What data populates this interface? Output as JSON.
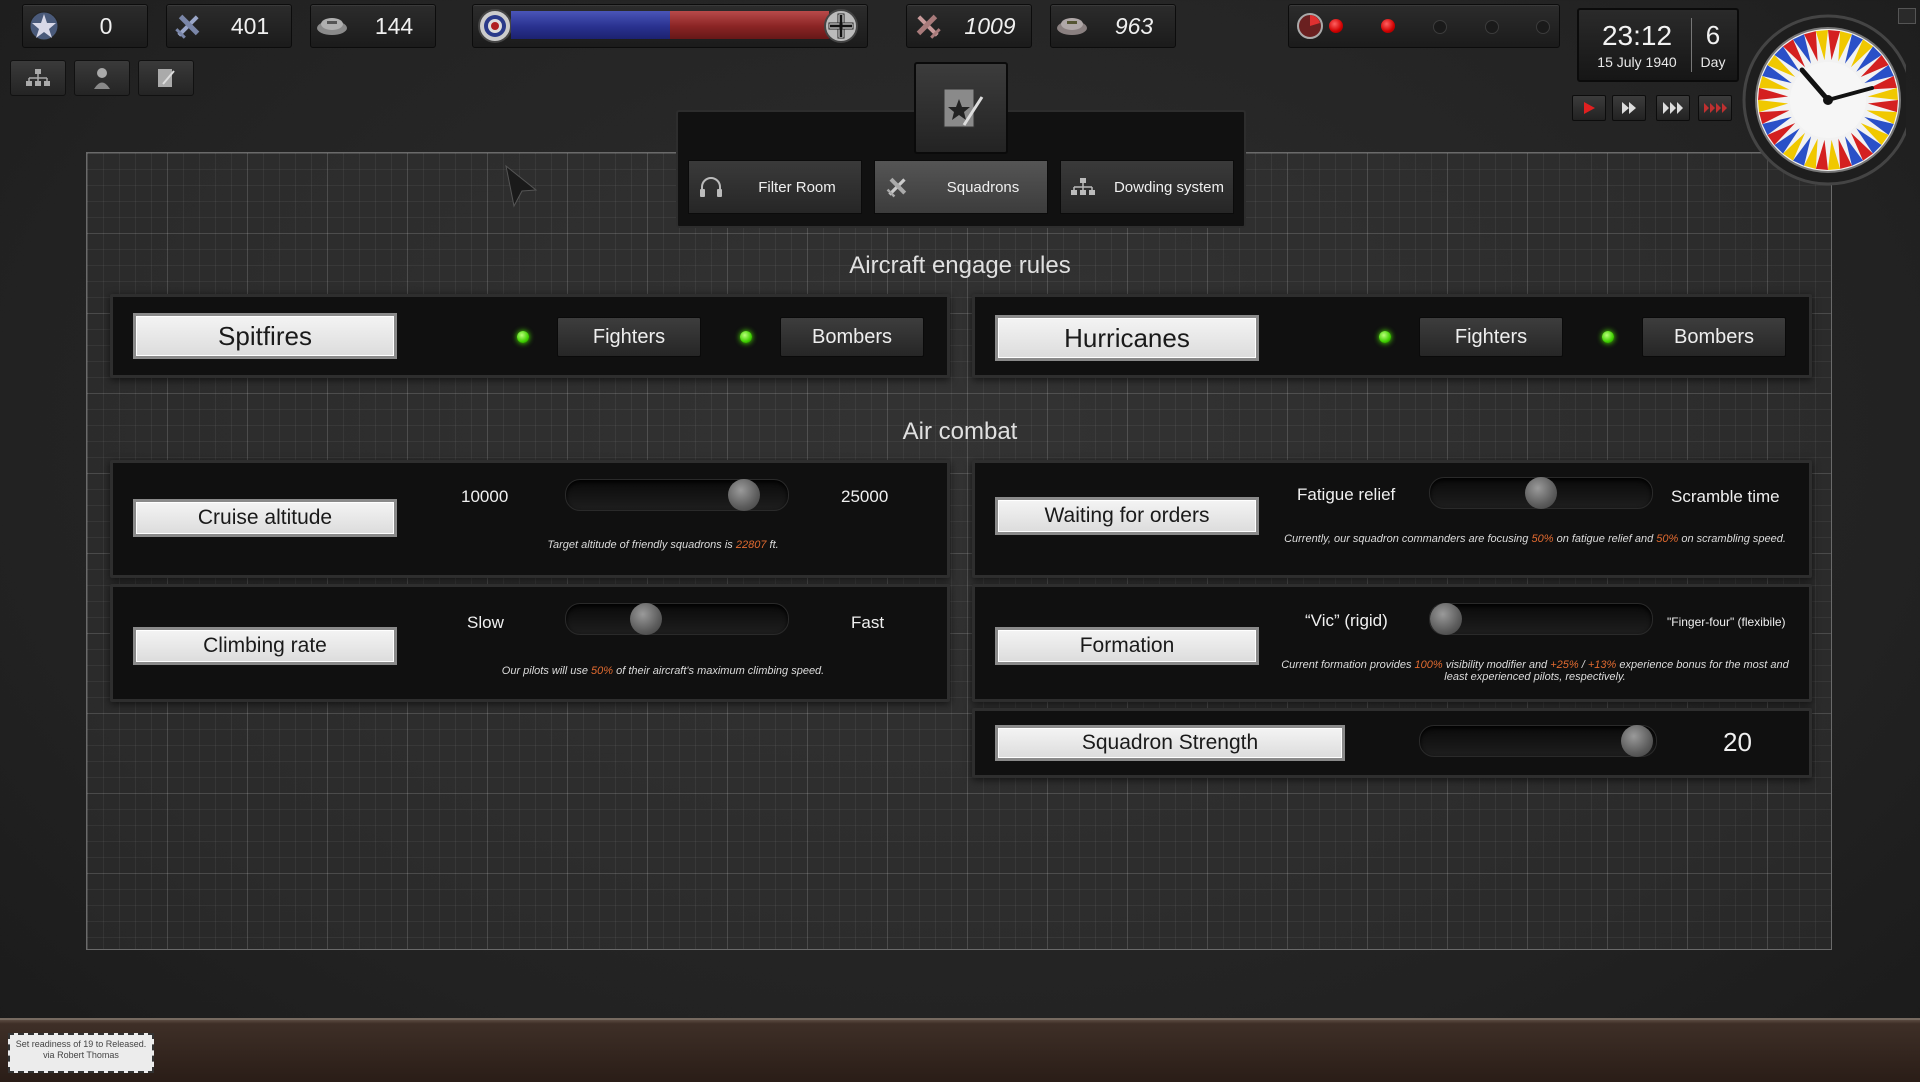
{
  "hud": {
    "medals": "0",
    "fighters": "401",
    "pilots": "144",
    "enemy_aircraft": "1009",
    "enemy_pilots": "963",
    "balance_allied_pct": 50
  },
  "tabs": [
    {
      "label": "Filter Room",
      "icon": "headphones-icon"
    },
    {
      "label": "Squadrons",
      "icon": "plane-icon",
      "active": true
    },
    {
      "label": "Dowding system",
      "icon": "hierarchy-icon"
    }
  ],
  "engage": {
    "title": "Aircraft engage rules",
    "left": {
      "name": "Spitfires",
      "fighters": "Fighters",
      "bombers": "Bombers"
    },
    "right": {
      "name": "Hurricanes",
      "fighters": "Fighters",
      "bombers": "Bombers"
    }
  },
  "combat": {
    "title": "Air combat",
    "cruise": {
      "label": "Cruise altitude",
      "min": "10000",
      "max": "25000",
      "value_fraction": 0.8,
      "note_pre": "Target altitude of friendly squadrons is ",
      "note_val": "22807",
      "note_post": " ft."
    },
    "climb": {
      "label": "Climbing rate",
      "min": "Slow",
      "max": "Fast",
      "value_fraction": 0.36,
      "note_pre": "Our pilots will use ",
      "note_val": "50%",
      "note_post": " of their aircraft's maximum climbing speed."
    },
    "waiting": {
      "label": "Waiting for orders",
      "min": "Fatigue relief",
      "max": "Scramble time",
      "value_fraction": 0.5,
      "note_pre": "Currently, our squadron commanders are focusing ",
      "note_v1": "50%",
      "note_mid": " on fatigue relief and ",
      "note_v2": "50%",
      "note_post": " on scrambling speed."
    },
    "formation": {
      "label": "Formation",
      "min": "“Vic” (rigid)",
      "max": "\"Finger-four\" (flexibile)",
      "value_fraction": 0.0,
      "note_pre": "Current formation provides ",
      "note_v1": "100%",
      "note_mid": " visibility modifier and ",
      "note_v2": "+25%",
      "note_sep": " / ",
      "note_v3": "+13%",
      "note_post": " experience bonus for the most and least experienced pilots, respectively."
    },
    "strength": {
      "label": "Squadron Strength",
      "value": "20",
      "value_fraction": 0.92
    }
  },
  "clock": {
    "time": "23:12",
    "date": "15 July 1940",
    "day_num": "6",
    "day_label": "Day"
  },
  "message": "Set readiness of 19 to Released. via Robert Thomas",
  "colors": {
    "accent_red": "#e06a30",
    "led_green": "#3fd000"
  }
}
